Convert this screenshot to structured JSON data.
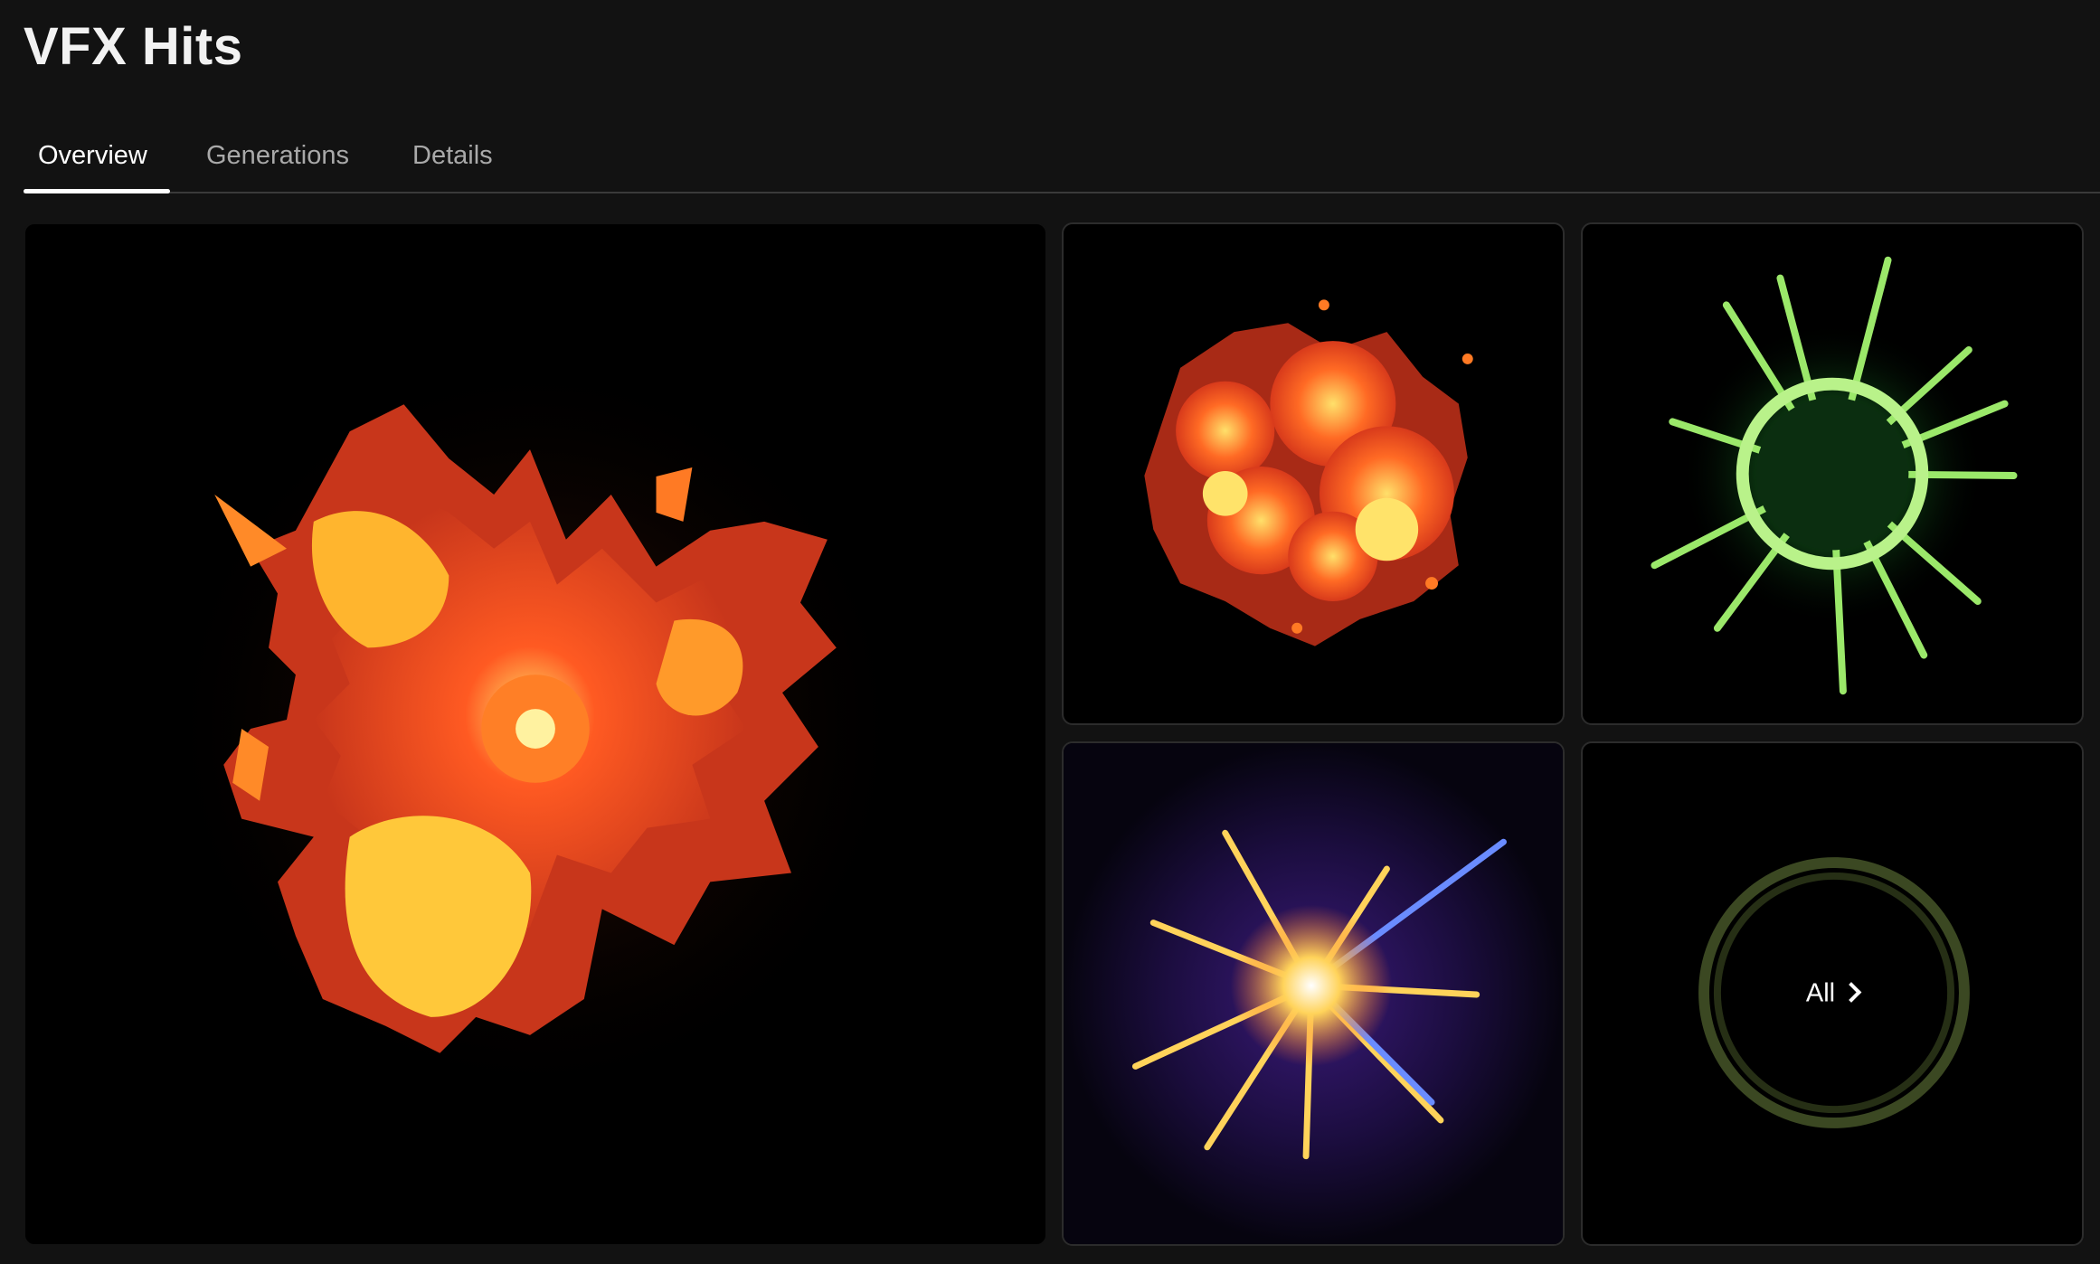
{
  "header": {
    "title": "VFX Hits"
  },
  "tabs": [
    {
      "label": "Overview",
      "active": true
    },
    {
      "label": "Generations",
      "active": false
    },
    {
      "label": "Details",
      "active": false
    }
  ],
  "gallery": {
    "all_label": "All",
    "colors": {
      "fire_dark": "#c8361b",
      "fire_mid": "#ff5a22",
      "fire_light": "#ffc83a",
      "green": "#9be86a",
      "spark_violet": "#6a3cff",
      "spark_gold": "#ffd35a"
    }
  }
}
